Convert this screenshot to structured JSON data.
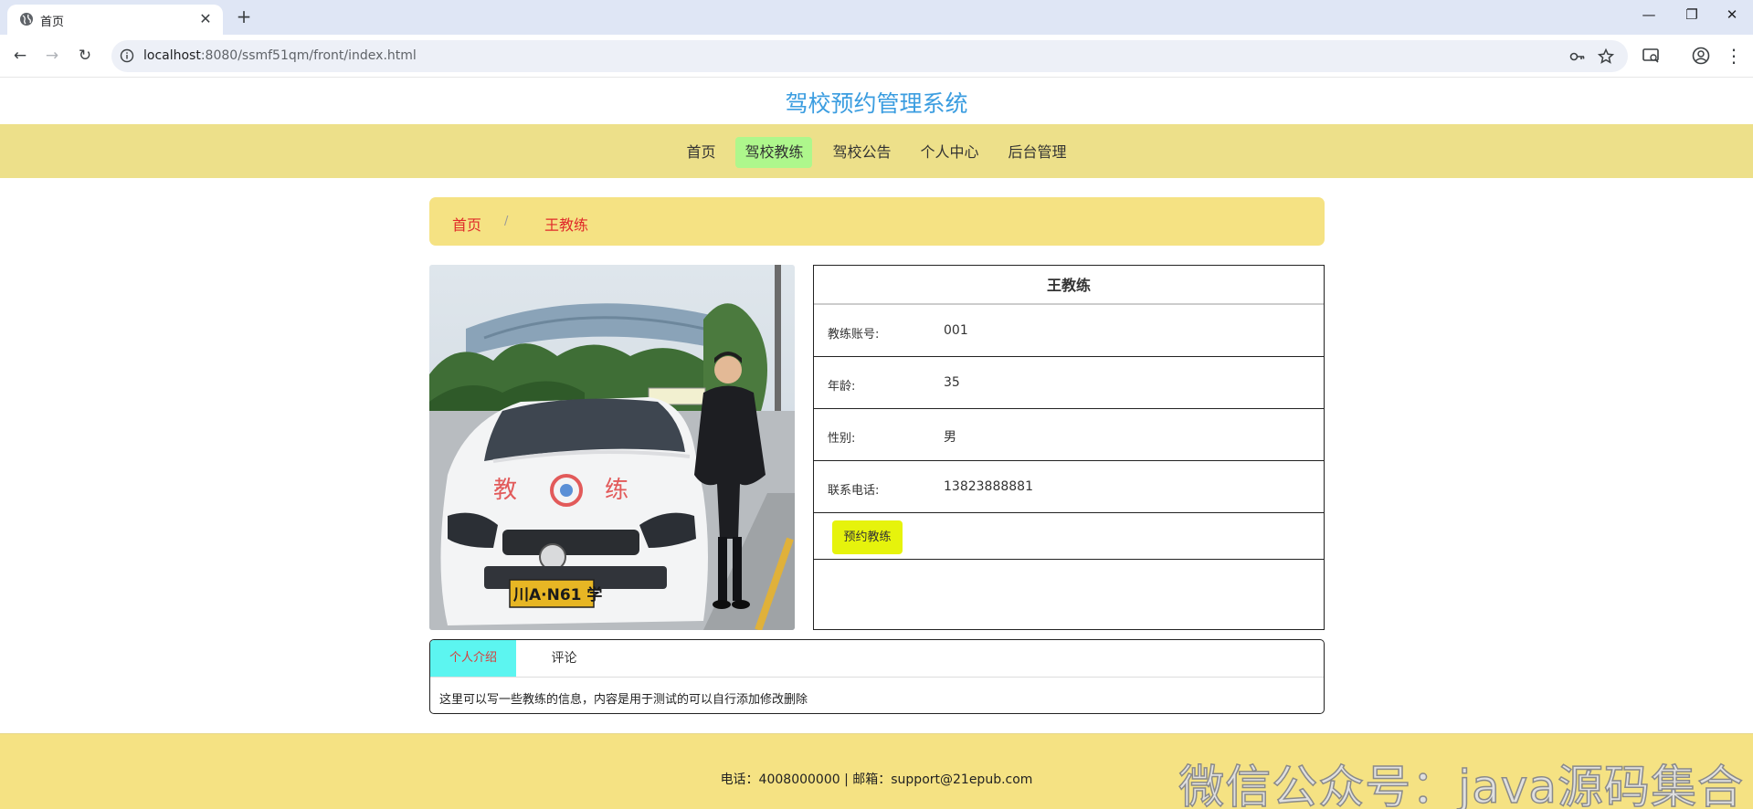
{
  "browser": {
    "tab_title": "首页",
    "url_host": "localhost",
    "url_path": ":8080/ssmf51qm/front/index.html"
  },
  "site": {
    "title": "驾校预约管理系统"
  },
  "nav": {
    "items": [
      "首页",
      "驾校教练",
      "驾校公告",
      "个人中心",
      "后台管理"
    ],
    "active_index": 1
  },
  "breadcrumb": {
    "home": "首页",
    "separator": "/",
    "current": "王教练"
  },
  "coach": {
    "name": "王教练",
    "fields": [
      {
        "label": "教练账号:",
        "value": "001"
      },
      {
        "label": "年龄:",
        "value": "35"
      },
      {
        "label": "性别:",
        "value": "男"
      },
      {
        "label": "联系电话:",
        "value": "13823888881"
      }
    ],
    "book_button": "预约教练",
    "photo_plate": "川A·N61 学",
    "photo_car_text_left": "教",
    "photo_car_text_right": "练"
  },
  "detail_tabs": {
    "items": [
      "个人介绍",
      "评论"
    ],
    "active_index": 0,
    "content": "这里可以写一些教练的信息，内容是用于测试的可以自行添加修改删除"
  },
  "footer": {
    "text": "电话：4008000000 | 邮箱：support@21epub.com"
  },
  "watermark": "微信公众号：java源码集合",
  "colors": {
    "title_blue": "#3b9de0",
    "navbar_bg": "#ede08a",
    "nav_active_bg": "#aef78c",
    "breadcrumb_bg": "#f5e283",
    "breadcrumb_text": "#e02a2a",
    "book_button_bg": "#e6f30c",
    "tab_active_bg": "#5cf5f0",
    "footer_bg": "#f5e283"
  }
}
